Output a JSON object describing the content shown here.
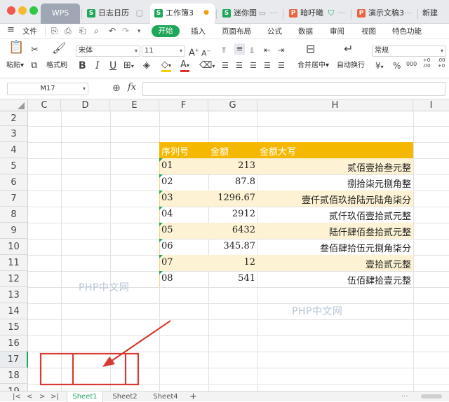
{
  "window": {
    "traffic_colors": [
      "#f2564d",
      "#f8b92e",
      "#33c748"
    ]
  },
  "tabs": [
    {
      "label": "WPS",
      "icon": ""
    },
    {
      "label": "日志日历",
      "icon": "S",
      "color": "#1ea65a"
    },
    {
      "label": "工作簿3",
      "icon": "S",
      "color": "#1ea65a",
      "active": true,
      "dot": "●"
    },
    {
      "label": "迷你图",
      "icon": "S",
      "color": "#1ea65a"
    },
    {
      "label": "暗吁曦",
      "icon": "P",
      "color": "#e9643f"
    },
    {
      "label": "演示文稿3",
      "icon": "P",
      "color": "#e9643f"
    },
    {
      "label": "新建",
      "icon": ""
    }
  ],
  "menu": {
    "hamburger": "≡",
    "file": "文件",
    "start": "开始",
    "items": [
      "插入",
      "页面布局",
      "公式",
      "数据",
      "审阅",
      "视图",
      "特色功能"
    ]
  },
  "ribbon": {
    "paste": "粘贴",
    "format_painter": "格式刷",
    "font_name": "宋体",
    "font_size": "11",
    "bold": "B",
    "italic": "I",
    "underline": "U",
    "merge_center": "合并居中",
    "wrap_text": "自动换行",
    "number_format": "常规",
    "currency": "¥",
    "percent": "%",
    "thousands": "000",
    "dec_inc": "+0 .00",
    "dec_dec": ".00 +0",
    "font_color_a": "A",
    "grow_a": "A",
    "shrink_a": "A"
  },
  "formula_bar": {
    "name_box": "M17",
    "fx": "fx",
    "zoom": "⊕"
  },
  "columns": [
    "C",
    "D",
    "E",
    "F",
    "G",
    "H",
    "I"
  ],
  "rows": [
    "2",
    "3",
    "4",
    "5",
    "6",
    "7",
    "8",
    "9",
    "10",
    "11",
    "12",
    "13",
    "14",
    "15",
    "16",
    "17",
    "18",
    "19"
  ],
  "table": {
    "headers": [
      "序列号",
      "金额",
      "金额大写"
    ],
    "rows": [
      [
        "01",
        "213",
        "贰佰壹拾叁元整"
      ],
      [
        "02",
        "87.8",
        "捌拾柒元捌角整"
      ],
      [
        "03",
        "1296.67",
        "壹仟贰佰玖拾陆元陆角柒分"
      ],
      [
        "04",
        "2912",
        "贰仟玖佰壹拾贰元整"
      ],
      [
        "05",
        "6432",
        "陆仟肆佰叁拾贰元整"
      ],
      [
        "06",
        "345.87",
        "叁佰肆拾伍元捌角柒分"
      ],
      [
        "07",
        "12",
        "壹拾贰元整"
      ],
      [
        "08",
        "541",
        "伍佰肆拾壹元整"
      ]
    ],
    "header_color": "#f5b800",
    "band_color": "#fdf2d3",
    "text_color": "#ffffff"
  },
  "watermark": "PHP中文网",
  "annotation_color": "#d63a32",
  "sheets": [
    "Sheet1",
    "Sheet2",
    "Sheet4"
  ],
  "sheet_nav": [
    "|<",
    "<",
    ">",
    ">|"
  ],
  "add_sheet": "+"
}
